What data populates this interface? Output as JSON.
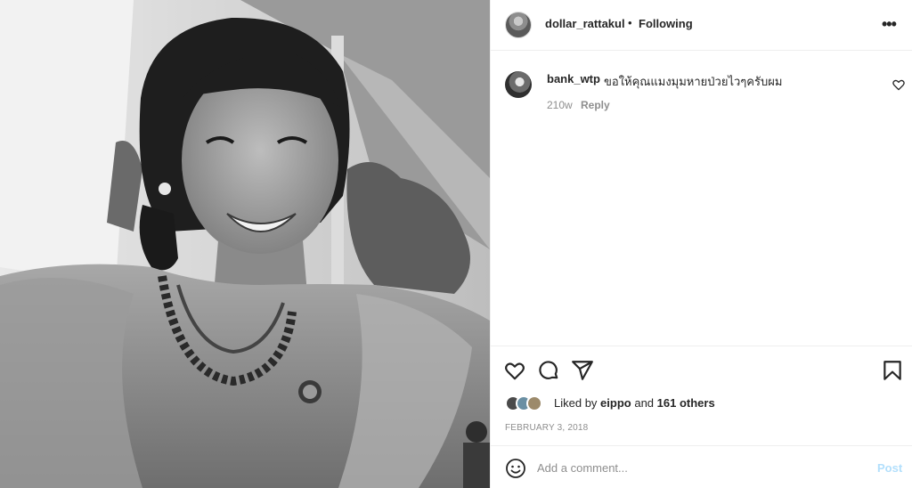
{
  "post": {
    "author": "dollar_rattakul",
    "separator": "•",
    "follow_status": "Following",
    "more_icon": "more-horizontal-icon",
    "photo_alt": "Black and white selfie of a smiling woman in a lace dress and beaded necklace under a tent"
  },
  "comments": [
    {
      "user": "bank_wtp",
      "text": "ขอให้คุณแมงมุมหายป่วยไวๆครับผม",
      "time": "210w",
      "reply_label": "Reply"
    }
  ],
  "actions": {
    "like_icon": "heart-icon",
    "comment_icon": "comment-icon",
    "share_icon": "send-icon",
    "save_icon": "bookmark-icon"
  },
  "likes": {
    "prefix": "Liked by",
    "user": "eippo",
    "joiner": "and",
    "others": "161 others"
  },
  "date": "FEBRUARY 3, 2018",
  "add_comment": {
    "placeholder": "Add a comment...",
    "post_label": "Post",
    "emoji_icon": "emoji-icon"
  },
  "colors": {
    "text": "#262626",
    "secondary": "#8e8e8e",
    "post_disabled": "#b2dffc",
    "border": "#efefef"
  }
}
